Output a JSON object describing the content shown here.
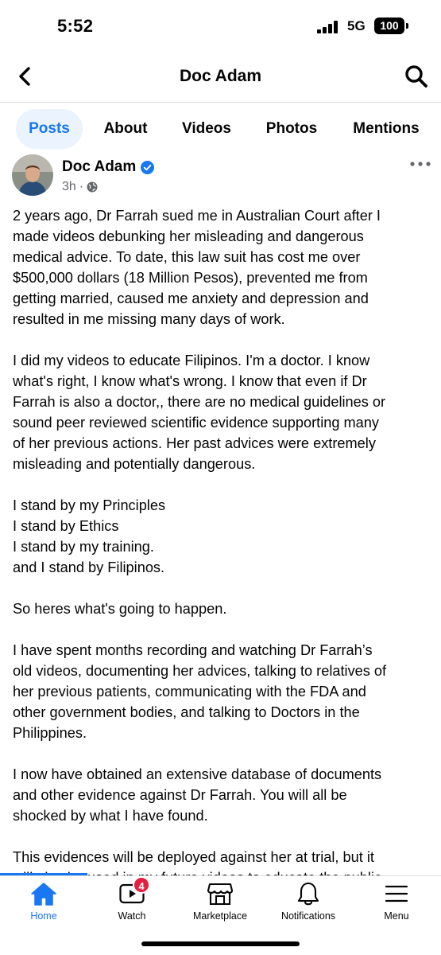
{
  "status_bar": {
    "time": "5:52",
    "network": "5G",
    "battery": "100"
  },
  "header": {
    "title": "Doc Adam"
  },
  "tabs": [
    {
      "label": "Posts",
      "active": true
    },
    {
      "label": "About",
      "active": false
    },
    {
      "label": "Videos",
      "active": false
    },
    {
      "label": "Photos",
      "active": false
    },
    {
      "label": "Mentions",
      "active": false
    }
  ],
  "post": {
    "author": "Doc Adam",
    "time": "3h",
    "paragraphs": [
      [
        "2 years ago, Dr Farrah sued me in Australian Court after I",
        "made videos debunking her misleading and dangerous",
        "medical advice. To date, this law suit has cost me over",
        "$500,000 dollars (18 Million Pesos), prevented me from",
        "getting married, caused me anxiety and depression and",
        "resulted in me missing many days of work."
      ],
      [
        "I did my videos to educate Filipinos. I'm a doctor. I know",
        "what's right, I know what's wrong. I know that even if Dr",
        "Farrah is also a doctor,, there are no medical guidelines or",
        "sound peer reviewed scientific evidence supporting many",
        "of her previous actions. Her past advices were extremely",
        "misleading and potentially dangerous."
      ],
      [
        "I stand by my Principles",
        "I stand by Ethics",
        "I stand by my training.",
        "and I stand by Filipinos."
      ],
      [
        "So heres what's going to happen."
      ],
      [
        "I have spent months recording and watching Dr Farrah’s",
        "old videos, documenting her advices, talking to relatives of",
        "her previous patients, communicating with the FDA and",
        "other government bodies, and talking to Doctors in the",
        "Philippines."
      ],
      [
        "I now have obtained an extensive database of documents",
        "and other evidence against Dr Farrah. You will all be",
        "shocked by what I have found."
      ],
      [
        "This evidences will be deployed against her at trial, but it",
        "will also be used in my future videos to educate the public"
      ]
    ]
  },
  "bottom_nav": [
    {
      "label": "Home",
      "icon": "home-icon",
      "active": true
    },
    {
      "label": "Watch",
      "icon": "watch-icon",
      "active": false,
      "badge": "4"
    },
    {
      "label": "Marketplace",
      "icon": "marketplace-icon",
      "active": false
    },
    {
      "label": "Notifications",
      "icon": "bell-icon",
      "active": false
    },
    {
      "label": "Menu",
      "icon": "menu-icon",
      "active": false
    }
  ],
  "colors": {
    "accent": "#1877f2",
    "badge": "#e41e3f",
    "verified": "#1877f2",
    "muted": "#65676b"
  }
}
